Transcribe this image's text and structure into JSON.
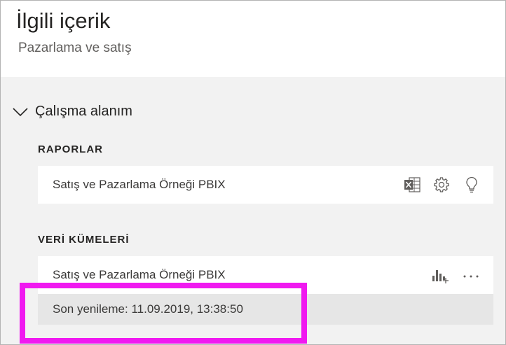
{
  "header": {
    "title": "İlgili içerik",
    "subtitle": "Pazarlama ve satış"
  },
  "workspace": {
    "label": "Çalışma alanım",
    "toggle_icon": "chevron-down-icon"
  },
  "reports": {
    "heading": "RAPORLAR",
    "items": [
      {
        "name": "Satış ve Pazarlama Örneği PBIX",
        "icons": [
          "excel-icon",
          "gear-icon",
          "lightbulb-icon"
        ]
      }
    ]
  },
  "datasets": {
    "heading": "VERİ KÜMELERİ",
    "items": [
      {
        "name": "Satış ve Pazarlama Örneği PBIX",
        "icons": [
          "create-report-icon",
          "more-options-icon"
        ]
      }
    ],
    "refresh": "Son yenileme: 11.09.2019, 13:38:50"
  },
  "colors": {
    "background": "#f2f2f2",
    "card": "#ffffff",
    "highlight": "#f019f0",
    "refresh_row": "#e6e6e6"
  }
}
